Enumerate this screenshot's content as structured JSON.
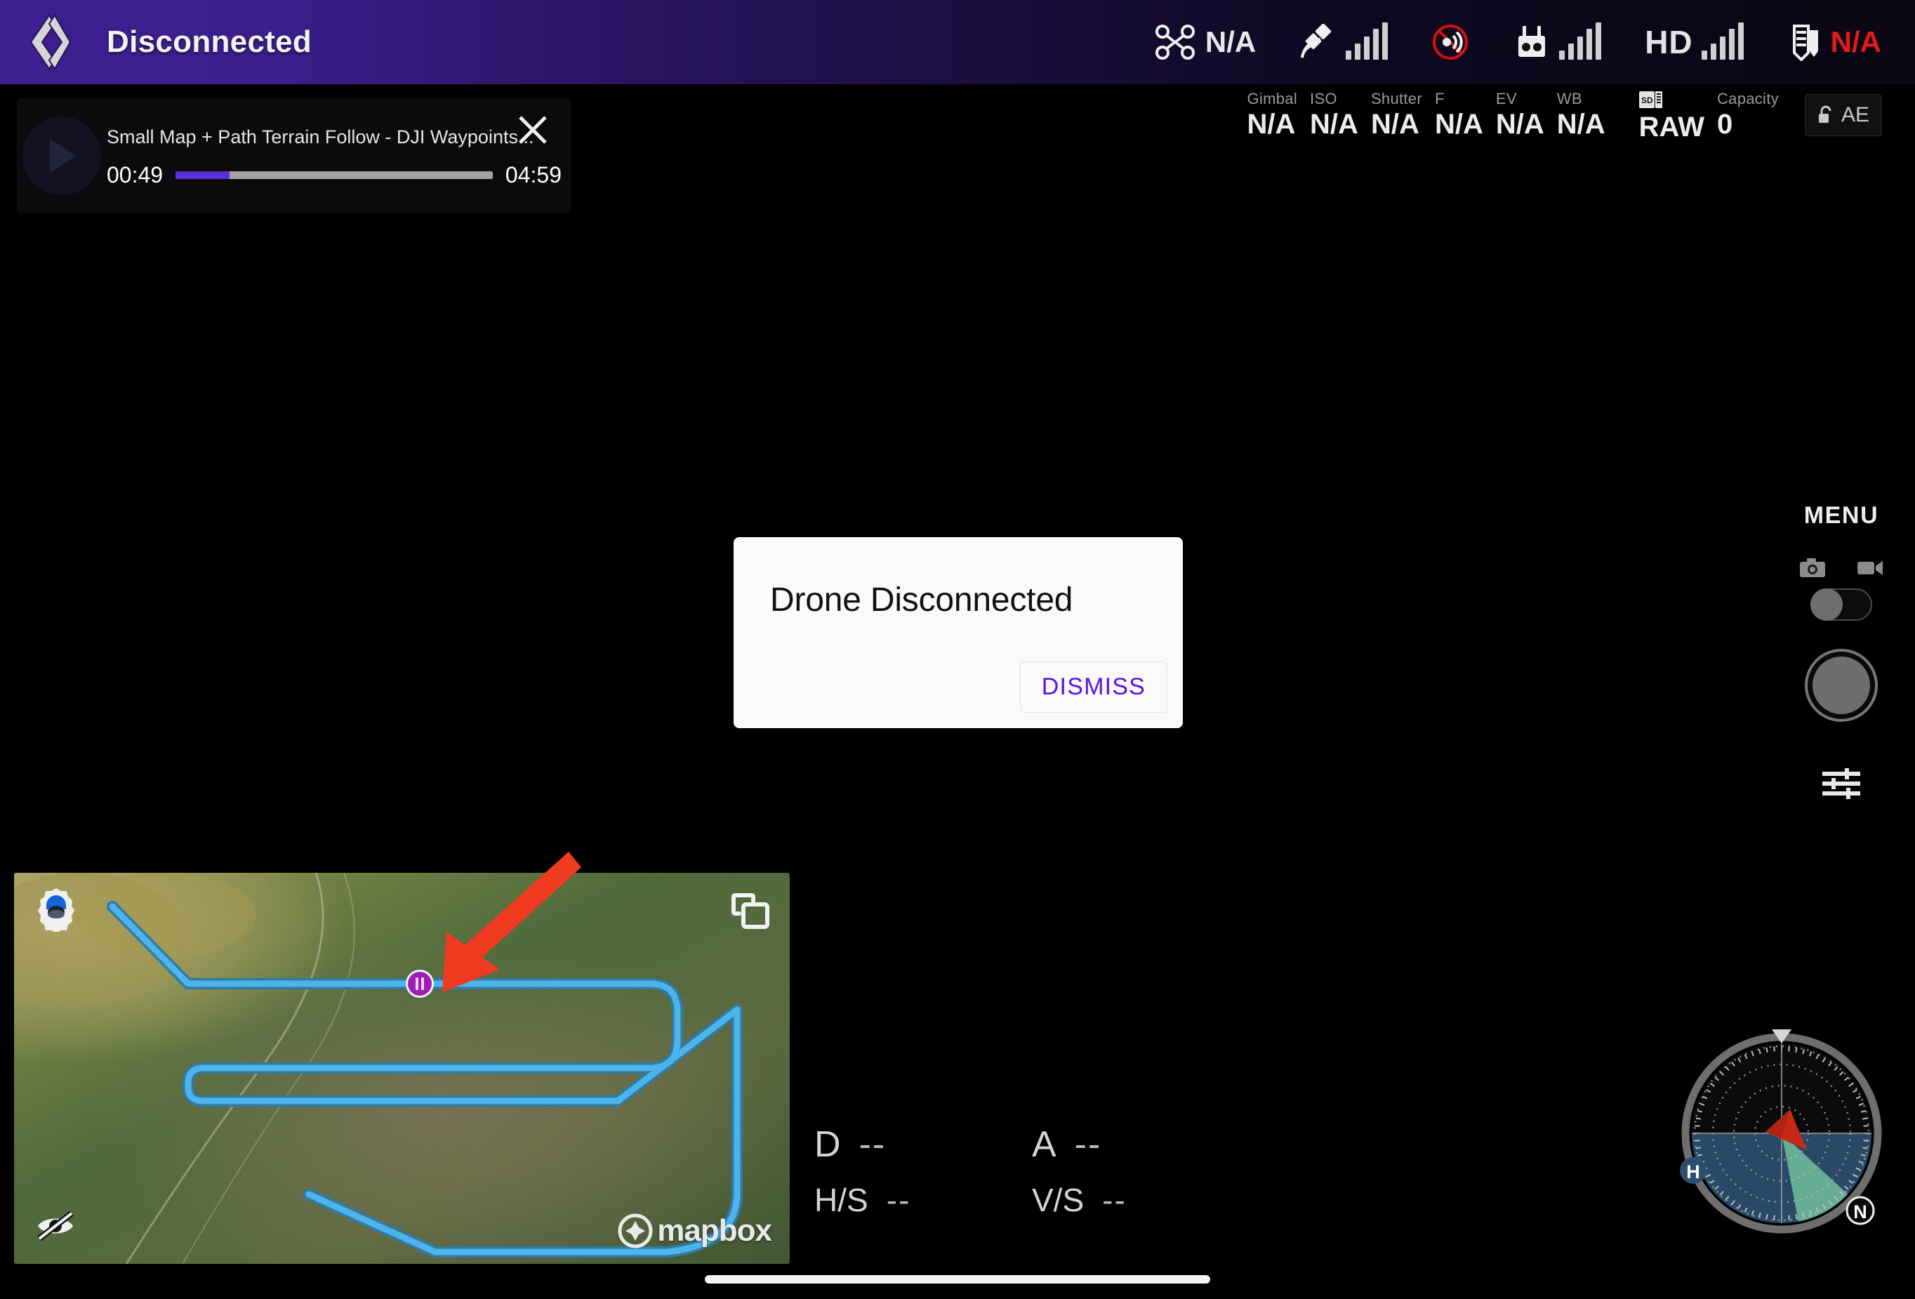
{
  "app": {
    "logo_icon": "diamond-rhombus-logo",
    "status_title": "Disconnected",
    "topbar_accent": "#3d1f8f"
  },
  "status_icons": [
    {
      "name": "drone-icon",
      "icon": "drone",
      "value": "N/A",
      "value_color": "#e8e8e8",
      "bars": 0
    },
    {
      "name": "satellite-gps-icon",
      "icon": "satellite",
      "value": "",
      "value_color": "#e8e8e8",
      "bars": 5
    },
    {
      "name": "rc-signal-disabled-icon",
      "icon": "signal-off",
      "value": "",
      "value_color": "#e01b1b",
      "bars": 0
    },
    {
      "name": "remote-controller-icon",
      "icon": "controller",
      "value": "",
      "value_color": "#e8e8e8",
      "bars": 5
    },
    {
      "name": "hd-video-icon",
      "icon": "hd",
      "value": "",
      "value_color": "#e8e8e8",
      "bars": 5
    },
    {
      "name": "battery-icon",
      "icon": "battery",
      "value": "N/A",
      "value_color": "#e01b1b",
      "bars": 0
    }
  ],
  "camera": {
    "cells": [
      {
        "label": "Gimbal",
        "value": "N/A"
      },
      {
        "label": "ISO",
        "value": "N/A"
      },
      {
        "label": "Shutter",
        "value": "N/A"
      },
      {
        "label": "F",
        "value": "N/A"
      },
      {
        "label": "EV",
        "value": "N/A"
      },
      {
        "label": "WB",
        "value": "N/A"
      }
    ],
    "storage": [
      {
        "label": "SD",
        "value": "RAW",
        "icon": "sd-card-icon"
      },
      {
        "label": "Capacity",
        "value": "0",
        "icon": ""
      }
    ],
    "ae_lock_label": "AE",
    "ae_lock_icon": "unlocked-padlock-icon"
  },
  "video_card": {
    "title": "Small Map + Path Terrain Follow - DJI Waypoints...",
    "elapsed": "00:49",
    "duration": "04:59",
    "progress_percent": 17,
    "play_icon": "play-icon",
    "close_icon": "close-x-icon",
    "progress_color": "#5a32d6"
  },
  "dialog": {
    "title": "Drone Disconnected",
    "dismiss_label": "DISMISS",
    "dismiss_color": "#5b12e8"
  },
  "rail": {
    "menu_label": "MENU",
    "photo_icon": "camera-photo-icon",
    "video_icon": "video-camera-icon",
    "mode_toggle_state": "photo",
    "shutter_icon": "shutter-button",
    "settings_icon": "sliders-settings-icon"
  },
  "map": {
    "settings_icon": "map-settings-gear-icon",
    "swap_icon": "swap-view-icon",
    "hide_icon": "eye-off-icon",
    "attribution": "mapbox",
    "attribution_icon": "mapbox-logo-icon",
    "waypoint_marker_icon": "pause-waypoint-marker",
    "waypoint_marker_color": "#9b1fb5",
    "flight_path_color": "#3aa8e0"
  },
  "annotation": {
    "arrow_icon": "red-pointer-arrow",
    "arrow_color": "#ef3b1f"
  },
  "telemetry": {
    "rows": [
      {
        "key": "D",
        "value": "--",
        "key2": "A",
        "value2": "--"
      },
      {
        "key": "H/S",
        "value": "--",
        "key2": "V/S",
        "value2": "--"
      }
    ]
  },
  "radar": {
    "name": "attitude-radar-compass",
    "home_label": "H",
    "north_label": "N",
    "heading_color": "#c62a17",
    "fov_color": "#79c9a0"
  }
}
